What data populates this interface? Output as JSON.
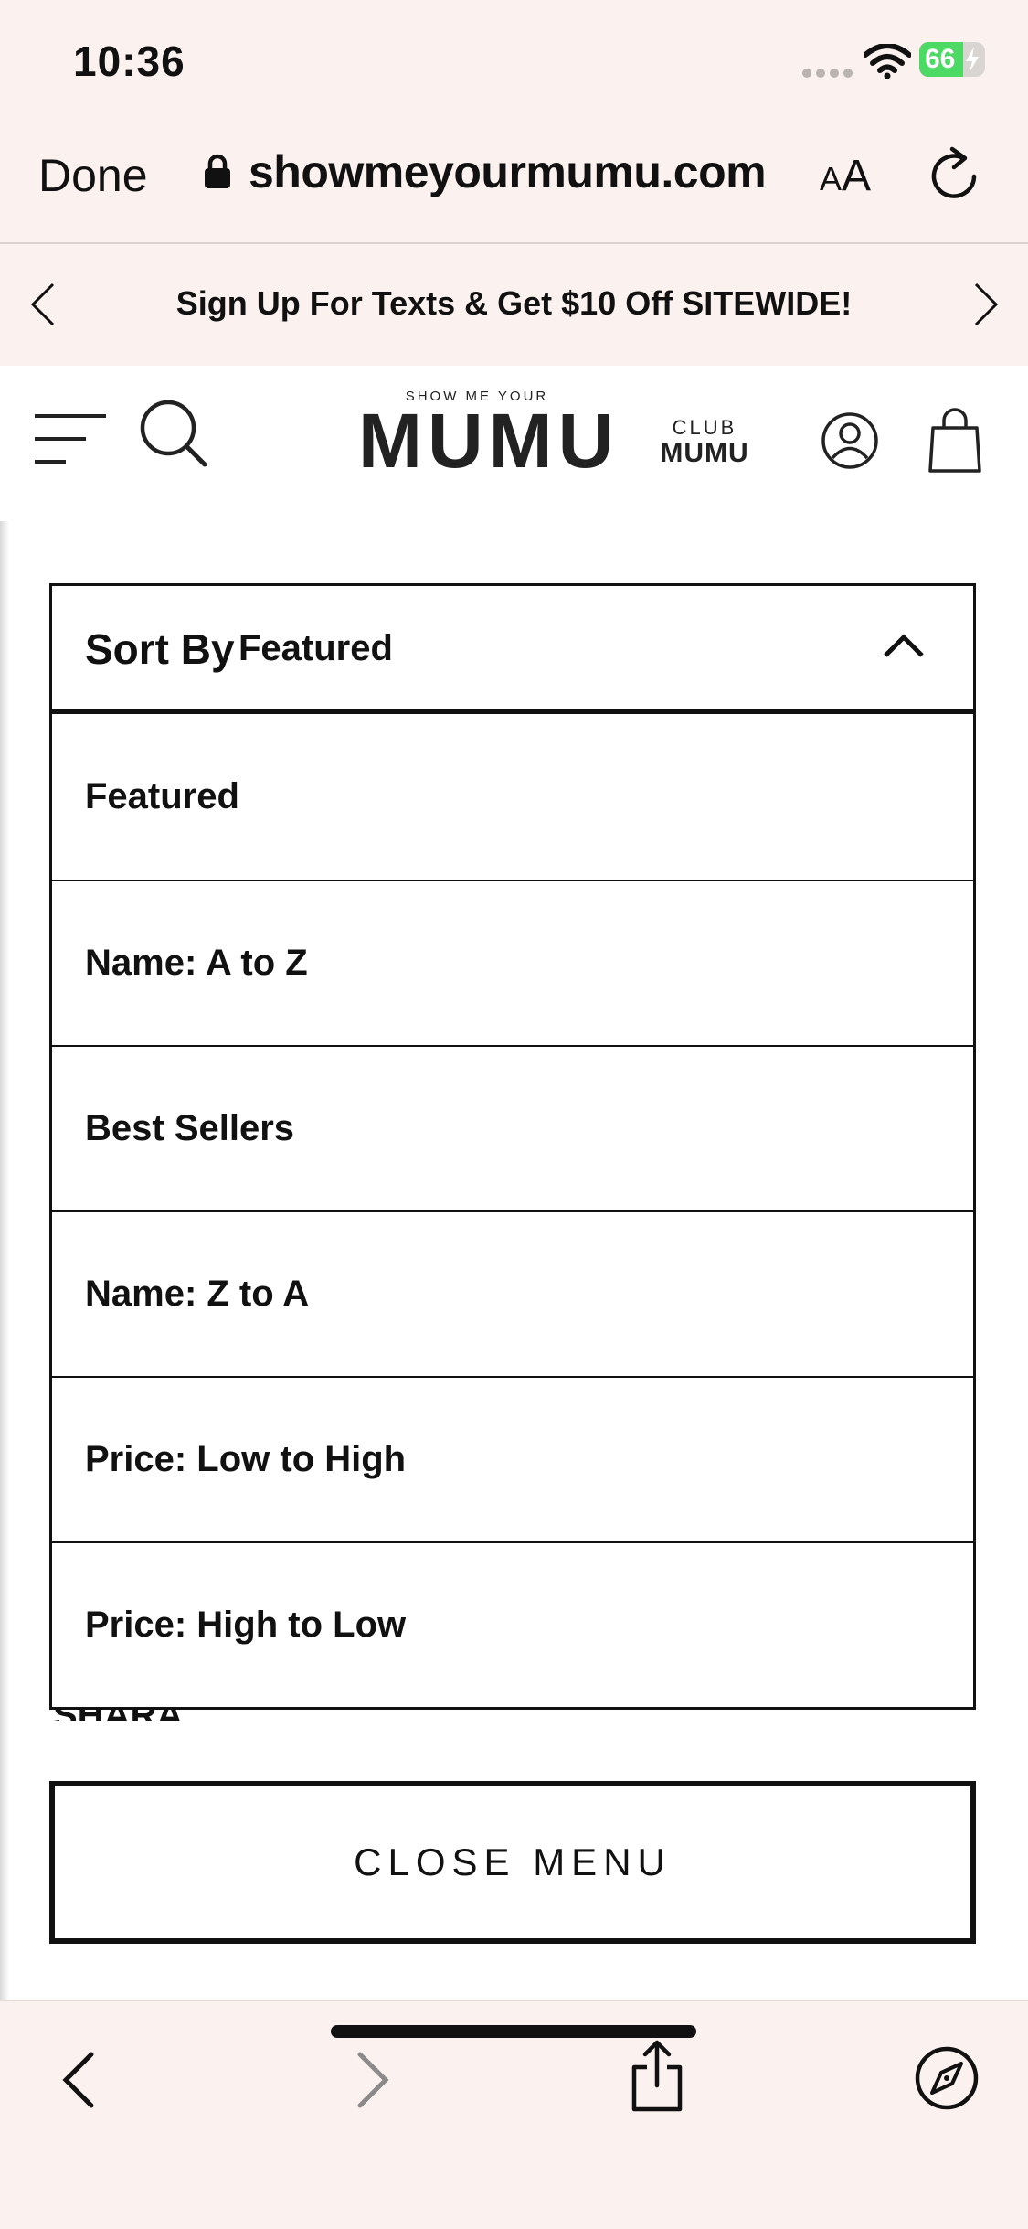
{
  "status_bar": {
    "time": "10:36",
    "battery": "66",
    "battery_level": 0.66
  },
  "browser": {
    "done_label": "Done",
    "url": "showmeyourmumu.com",
    "text_size_small": "A",
    "text_size_big": "A"
  },
  "promo": {
    "text": "Sign Up For Texts & Get $10 Off SITEWIDE!"
  },
  "header": {
    "logo_small": "SHOW ME YOUR",
    "logo_big": "MUMU",
    "club_top": "CLUB",
    "club_bottom": "MUMU"
  },
  "sort": {
    "label": "Sort By",
    "selected": "Featured",
    "options": [
      "Featured",
      "Name: A to Z",
      "Best Sellers",
      "Name: Z to A",
      "Price: Low to High",
      "Price: High to Low"
    ]
  },
  "close_menu_label": "CLOSE MENU",
  "colors": {
    "chrome_background": "#fbf1ee",
    "text": "#111111",
    "battery_green": "#4cd964"
  }
}
